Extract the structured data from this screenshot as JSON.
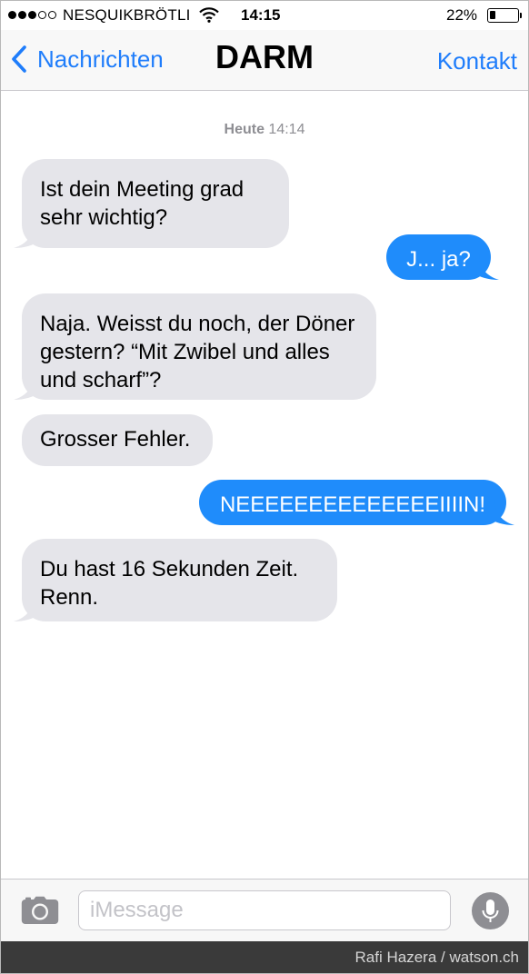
{
  "status_bar": {
    "carrier": "NESQUIKBRÖTLI",
    "time": "14:15",
    "battery": "22%",
    "battery_level": 0.22,
    "signal_bars_filled": 3,
    "signal_bars_total": 5
  },
  "nav": {
    "back_label": "Nachrichten",
    "title": "DARM",
    "contact_label": "Kontakt"
  },
  "conversation": {
    "timestamp_day": "Heute",
    "timestamp_time": "14:14",
    "messages": [
      {
        "direction": "in",
        "text": "Ist dein Meeting grad sehr wichtig?"
      },
      {
        "direction": "out",
        "text": "J... ja?"
      },
      {
        "direction": "in",
        "text": "Naja. Weisst du noch, der Döner gestern? “Mit Zwibel und alles und scharf”?"
      },
      {
        "direction": "in",
        "text": "Grosser Fehler."
      },
      {
        "direction": "out",
        "text": "NEEEEEEEEEEEEEEIIIIN!"
      },
      {
        "direction": "in",
        "text": "Du hast 16 Sekunden Zeit. Renn."
      }
    ]
  },
  "input": {
    "placeholder": "iMessage",
    "camera_icon": "camera-icon",
    "mic_icon": "microphone-icon"
  },
  "credit": "Rafi Hazera / watson.ch",
  "colors": {
    "accent": "#1f7dfb",
    "outgoing_bubble": "#1f8cfb",
    "incoming_bubble": "#e5e5ea",
    "timestamp": "#8e8e93",
    "credit_bar": "#3a3a3a"
  }
}
